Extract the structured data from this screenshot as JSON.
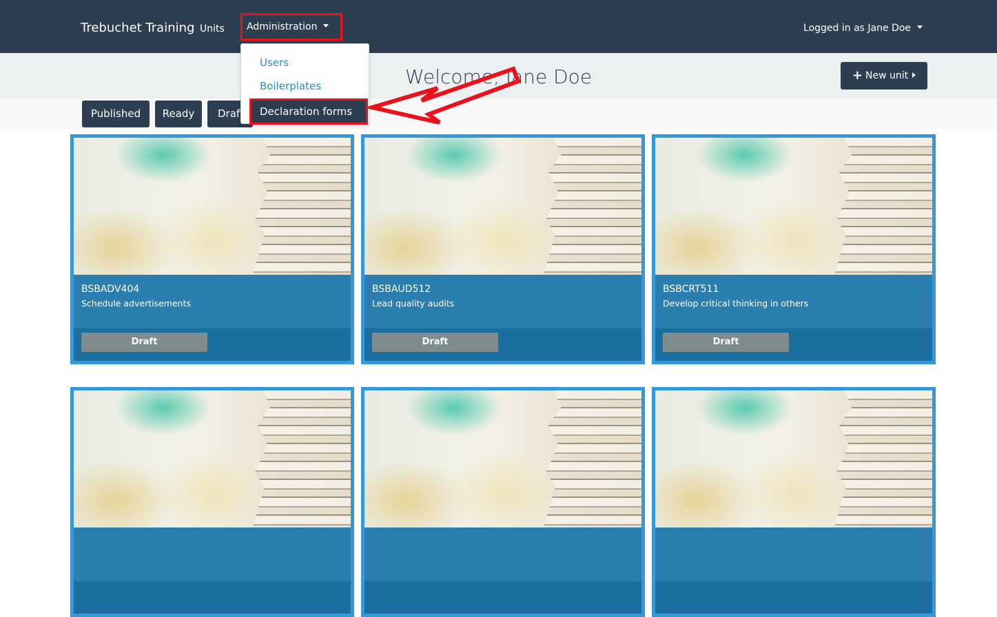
{
  "navbar": {
    "brand": "Trebuchet Training",
    "units_label": "Units",
    "admin_label": "Administration",
    "user_label": "Logged in as Jane Doe"
  },
  "admin_dropdown": {
    "items": [
      {
        "label": "Users"
      },
      {
        "label": "Boilerplates"
      },
      {
        "label": "Declaration forms"
      }
    ]
  },
  "welcome": {
    "title": "Welcome, Jane Doe",
    "new_unit_label": "New unit"
  },
  "filters": [
    "Published",
    "Ready",
    "Draft"
  ],
  "cards": [
    {
      "code": "BSBADV404",
      "name": "Schedule advertisements",
      "status": "Draft"
    },
    {
      "code": "BSBAUD512",
      "name": "Lead quality audits",
      "status": "Draft"
    },
    {
      "code": "BSBCRT511",
      "name": "Develop critical thinking in others",
      "status": "Draft"
    },
    {
      "code": "",
      "name": "",
      "status": ""
    },
    {
      "code": "",
      "name": "",
      "status": ""
    },
    {
      "code": "",
      "name": "",
      "status": ""
    }
  ],
  "colors": {
    "navbar": "#2c3e50",
    "card_border": "#3498db",
    "card_info": "#2a7fb0",
    "status_badge": "#7f8c8d",
    "highlight": "#e8111c",
    "link": "#2a8fc4"
  },
  "icons": [
    "caret-down-icon",
    "plus-icon",
    "caret-right-icon",
    "annotation-arrow-icon"
  ]
}
